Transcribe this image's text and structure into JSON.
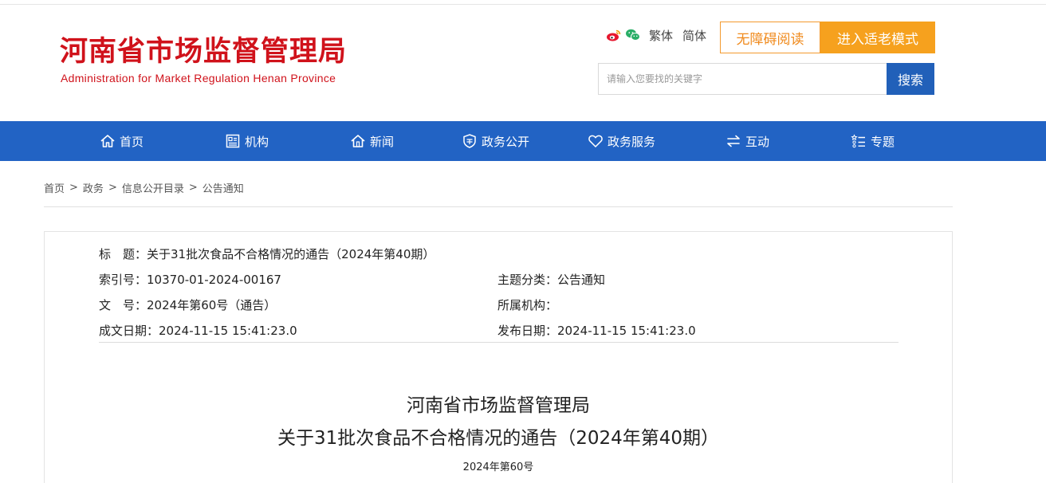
{
  "header": {
    "logo_cn": "河南省市场监督管理局",
    "logo_en": "Administration for Market Regulation Henan Province",
    "lang_traditional": "繁体",
    "lang_simplified": "简体",
    "accessibility_label": "无障碍阅读",
    "elder_mode_label": "进入适老模式",
    "search_placeholder": "请输入您要找的关键字",
    "search_button": "搜索",
    "social_icons": [
      "weibo-icon",
      "wechat-icon"
    ]
  },
  "nav": {
    "items": [
      {
        "label": "首页",
        "icon": "home-icon"
      },
      {
        "label": "机构",
        "icon": "org-icon"
      },
      {
        "label": "新闻",
        "icon": "news-icon"
      },
      {
        "label": "政务公开",
        "icon": "shield-icon"
      },
      {
        "label": "政务服务",
        "icon": "heart-icon"
      },
      {
        "label": "互动",
        "icon": "exchange-icon"
      },
      {
        "label": "专题",
        "icon": "list-star-icon"
      }
    ]
  },
  "breadcrumb": {
    "items": [
      "首页",
      "政务",
      "信息公开目录",
      "公告通知"
    ],
    "separator": ">"
  },
  "meta": {
    "title_label": "标　题：",
    "title_value": "关于31批次食品不合格情况的通告（2024年第40期）",
    "index_label": "索引号：",
    "index_value": "10370-01-2024-00167",
    "category_label": "主题分类：",
    "category_value": "公告通知",
    "docno_label": "文　号：",
    "docno_value": "2024年第60号（通告）",
    "org_label": "所属机构：",
    "org_value": "",
    "created_label": "成文日期：",
    "created_value": "2024-11-15 15:41:23.0",
    "published_label": "发布日期：",
    "published_value": "2024-11-15 15:41:23.0"
  },
  "document": {
    "title_line1": "河南省市场监督管理局",
    "title_line2": "关于31批次食品不合格情况的通告（2024年第40期）",
    "number": "2024年第60号"
  },
  "colors": {
    "brand_red": "#d0121b",
    "nav_blue": "#2263c4",
    "search_blue": "#2160b9",
    "elder_orange": "#f6a11e",
    "access_orange": "#f08a1c"
  }
}
